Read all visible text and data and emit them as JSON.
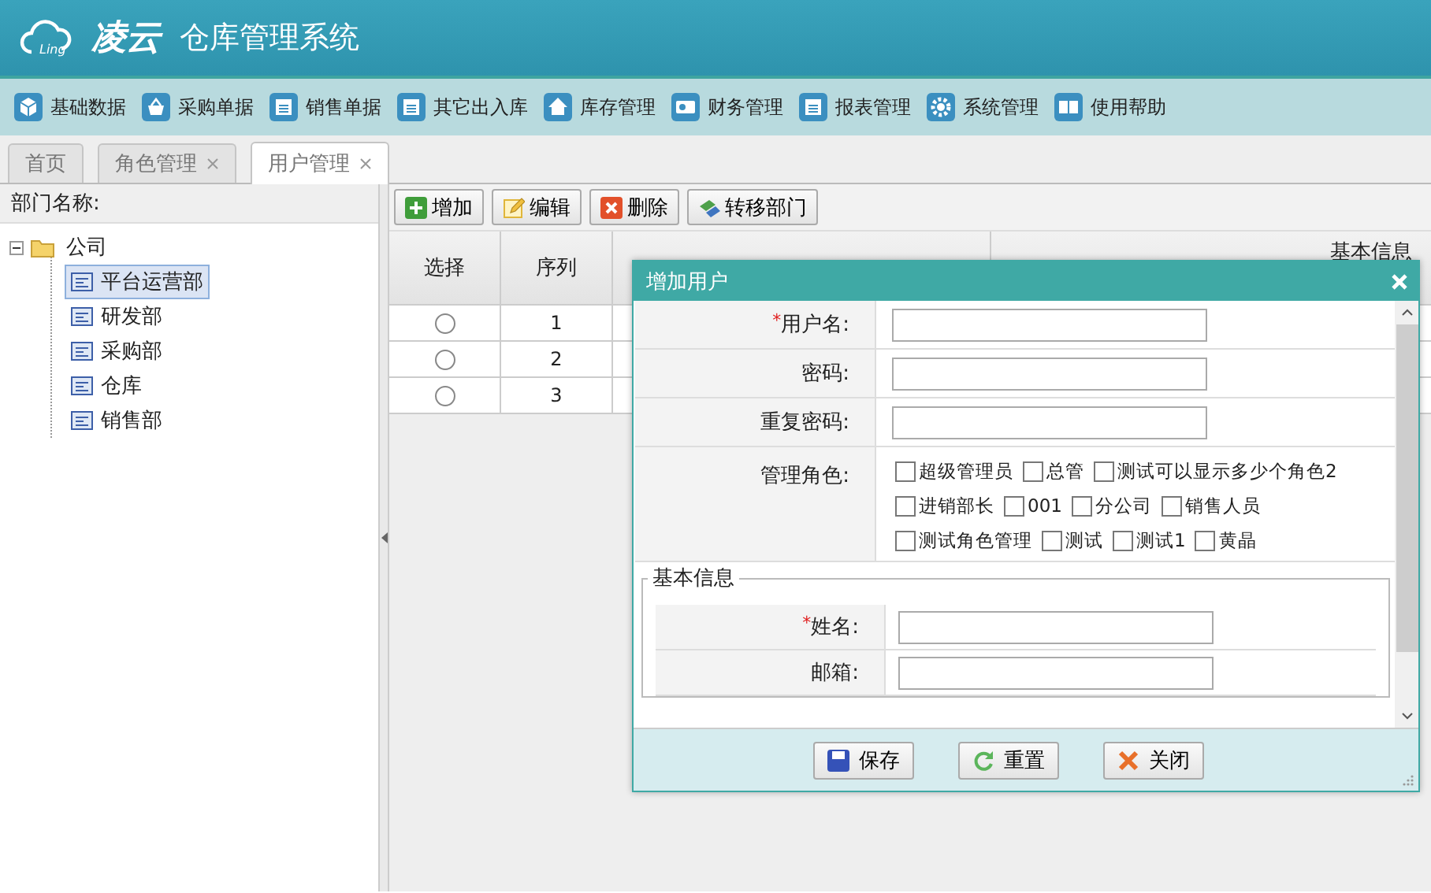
{
  "header": {
    "logo_mark": "Ling",
    "logo_text": "凌云",
    "title": "仓库管理系统"
  },
  "menu": [
    {
      "label": "基础数据"
    },
    {
      "label": "采购单据"
    },
    {
      "label": "销售单据"
    },
    {
      "label": "其它出入库"
    },
    {
      "label": "库存管理"
    },
    {
      "label": "财务管理"
    },
    {
      "label": "报表管理"
    },
    {
      "label": "系统管理"
    },
    {
      "label": "使用帮助"
    }
  ],
  "tabs": [
    {
      "label": "首页",
      "closable": false,
      "selected": false
    },
    {
      "label": "角色管理",
      "closable": true,
      "selected": false
    },
    {
      "label": "用户管理",
      "closable": true,
      "selected": true
    }
  ],
  "tree": {
    "header": "部门名称:",
    "root": {
      "label": "公司",
      "expanded": true,
      "children": [
        {
          "label": "平台运营部",
          "selected": true
        },
        {
          "label": "研发部",
          "selected": false
        },
        {
          "label": "采购部",
          "selected": false
        },
        {
          "label": "仓库",
          "selected": false
        },
        {
          "label": "销售部",
          "selected": false
        }
      ]
    }
  },
  "toolbar": [
    {
      "label": "增加",
      "kind": "add"
    },
    {
      "label": "编辑",
      "kind": "edit"
    },
    {
      "label": "删除",
      "kind": "delete"
    },
    {
      "label": "转移部门",
      "kind": "move"
    }
  ],
  "grid": {
    "group_header": "基本信息",
    "columns": [
      "选择",
      "序列"
    ],
    "rows": [
      {
        "selected": false,
        "index": "1"
      },
      {
        "selected": false,
        "index": "2"
      },
      {
        "selected": false,
        "index": "3"
      }
    ]
  },
  "dialog": {
    "title": "增加用户",
    "fields": [
      {
        "marker": "*",
        "label": "用户名:"
      },
      {
        "label": "密码:"
      },
      {
        "label": "重复密码:"
      }
    ],
    "roles": {
      "label": "管理角色:",
      "options": [
        {
          "label": "超级管理员",
          "checked": false
        },
        {
          "label": "总管",
          "checked": false
        },
        {
          "label": "测试可以显示多少个角色2",
          "checked": false
        },
        {
          "label": "进销部长",
          "checked": false
        },
        {
          "label": "001",
          "checked": false
        },
        {
          "label": "分公司",
          "checked": false
        },
        {
          "label": "销售人员",
          "checked": false
        },
        {
          "label": "测试角色管理",
          "checked": false
        },
        {
          "label": "测试",
          "checked": false
        },
        {
          "label": "测试1",
          "checked": false
        },
        {
          "label": "黄晶",
          "checked": false
        }
      ]
    },
    "fieldset": {
      "legend": "基本信息",
      "fields": [
        {
          "marker": "*",
          "label": "姓名:"
        },
        {
          "label": "邮箱:"
        }
      ]
    },
    "buttons": [
      {
        "label": "保存",
        "kind": "save"
      },
      {
        "label": "重置",
        "kind": "reset"
      },
      {
        "label": "关闭",
        "kind": "close"
      }
    ]
  }
}
